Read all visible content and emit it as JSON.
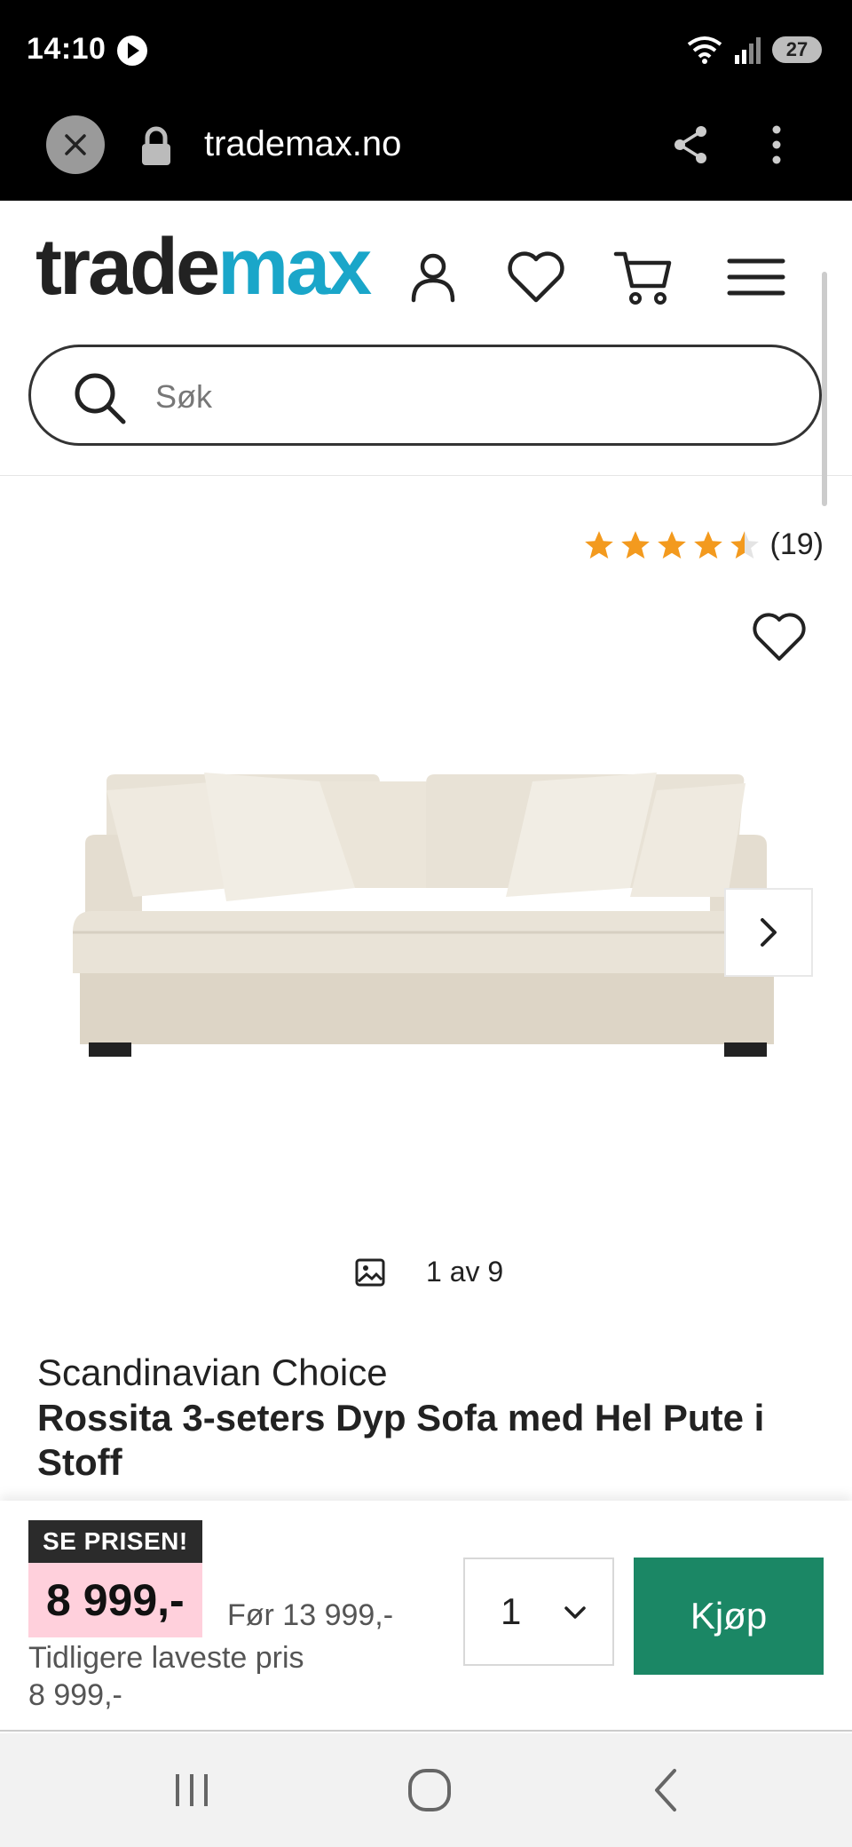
{
  "status_bar": {
    "time": "14:10",
    "battery": "27"
  },
  "browser": {
    "url": "trademax.no"
  },
  "header": {
    "logo_part1": "trade",
    "logo_part2": "max",
    "search_placeholder": "Søk"
  },
  "product": {
    "rating_stars": 4.5,
    "rating_count": "(19)",
    "gallery_counter": "1 av 9",
    "brand": "Scandinavian Choice",
    "title": "Rossita 3-seters Dyp Sofa med Hel Pute i Stoff"
  },
  "buy_bar": {
    "badge": "SE PRISEN!",
    "price": "8 999,-",
    "price_before": "Før 13 999,-",
    "lowest_price_label": "Tidligere laveste pris",
    "lowest_price_value": "8 999,-",
    "quantity": "1",
    "buy_label": "Kjøp"
  },
  "colors": {
    "logo_accent": "#1aa6c9",
    "star": "#f39a1e",
    "buy_button": "#1b8765",
    "price_highlight": "#ffd0dc"
  }
}
